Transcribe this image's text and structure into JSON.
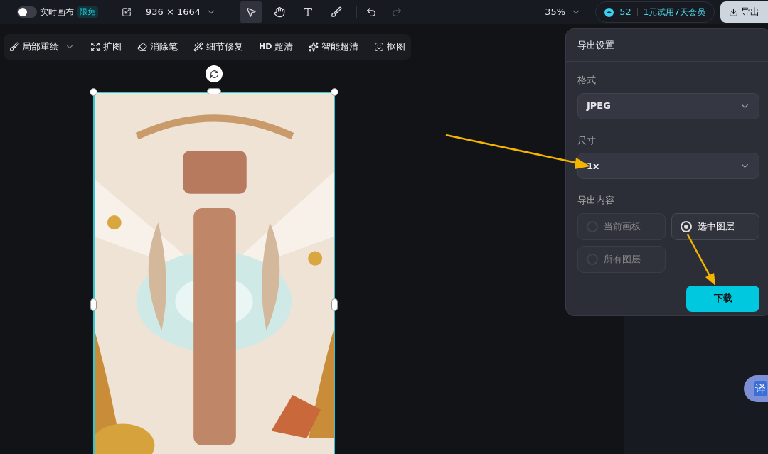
{
  "top_bar": {
    "realtime_toggle": {
      "label": "实时画布",
      "on": false
    },
    "badge": "限免",
    "canvas_size": "936 × 1664",
    "tools": [
      {
        "kind": "select",
        "selected": true
      },
      {
        "kind": "hand",
        "selected": false
      },
      {
        "kind": "text",
        "selected": false
      },
      {
        "kind": "brush",
        "selected": false
      }
    ],
    "undo": {
      "disabled": false
    },
    "redo": {
      "disabled": true
    },
    "zoom": "35%",
    "credits": "52",
    "promo": "1元试用7天会员",
    "export_button": "导出"
  },
  "edit_toolbar": [
    {
      "kind": "repaint",
      "label": "局部重绘",
      "dropdown": true
    },
    {
      "kind": "expand",
      "label": "扩图",
      "dropdown": false
    },
    {
      "kind": "eraser",
      "label": "消除笔",
      "dropdown": false
    },
    {
      "kind": "fix",
      "label": "细节修复",
      "dropdown": false
    },
    {
      "kind": "hd",
      "label": "超清",
      "icon_text": "HD",
      "dropdown": false
    },
    {
      "kind": "hdplus",
      "label": "智能超清",
      "dropdown": false
    },
    {
      "kind": "cutout",
      "label": "抠图",
      "dropdown": false
    }
  ],
  "export_panel": {
    "title": "导出设置",
    "format_label": "格式",
    "format_value": "JPEG",
    "size_label": "尺寸",
    "size_value": "1x",
    "content_label": "导出内容",
    "content_options": [
      {
        "label": "当前画板",
        "selected": false
      },
      {
        "label": "选中图层",
        "selected": true
      },
      {
        "label": "所有图层",
        "selected": false
      }
    ],
    "download_button": "下载"
  },
  "translate_button": "译"
}
